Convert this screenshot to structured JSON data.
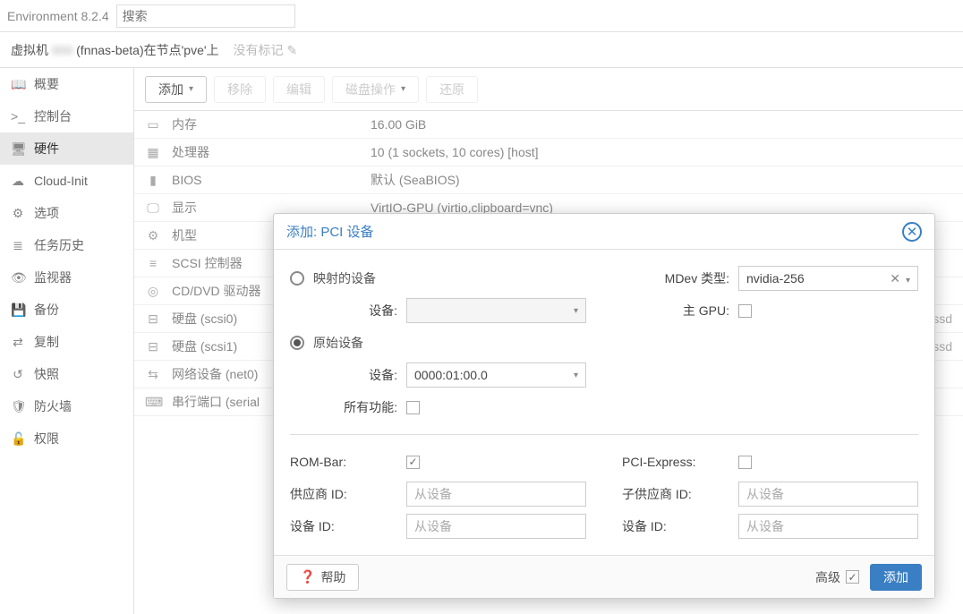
{
  "top": {
    "version": "Environment 8.2.4",
    "search_ph": "搜索"
  },
  "crumb": {
    "vm": "虚拟机",
    "host": "(fnnas-beta)在节点'pve'上",
    "tags": "没有标记",
    "edit_icon": "✎"
  },
  "sidebar": [
    {
      "icon": "📖",
      "label": "概要"
    },
    {
      "icon": ">_",
      "label": "控制台"
    },
    {
      "icon": "🖥",
      "label": "硬件",
      "active": true
    },
    {
      "icon": "☁",
      "label": "Cloud-Init"
    },
    {
      "icon": "⚙",
      "label": "选项"
    },
    {
      "icon": "≣",
      "label": "任务历史"
    },
    {
      "icon": "👁",
      "label": "监视器"
    },
    {
      "icon": "💾",
      "label": "备份"
    },
    {
      "icon": "⇄",
      "label": "复制"
    },
    {
      "icon": "↺",
      "label": "快照"
    },
    {
      "icon": "🛡",
      "label": "防火墙"
    },
    {
      "icon": "🔓",
      "label": "权限"
    }
  ],
  "toolbar": {
    "add": "添加",
    "remove": "移除",
    "edit": "编辑",
    "disk": "磁盘操作",
    "revert": "还原"
  },
  "hw": [
    {
      "icon": "▭",
      "label": "内存",
      "val": "16.00 GiB"
    },
    {
      "icon": "▦",
      "label": "处理器",
      "val": "10 (1 sockets, 10 cores) [host]"
    },
    {
      "icon": "▮",
      "label": "BIOS",
      "val": "默认 (SeaBIOS)"
    },
    {
      "icon": "🖵",
      "label": "显示",
      "val": "VirtIO-GPU (virtio,clipboard=vnc)"
    },
    {
      "icon": "⚙",
      "label": "机型",
      "val": ""
    },
    {
      "icon": "≡",
      "label": "SCSI 控制器",
      "val": ""
    },
    {
      "icon": "◎",
      "label": "CD/DVD 驱动器",
      "val": ""
    },
    {
      "icon": "⊟",
      "label": "硬盘 (scsi0)",
      "val": "",
      "tail": "ssd"
    },
    {
      "icon": "⊟",
      "label": "硬盘 (scsi1)",
      "val": "",
      "tail": "ssd"
    },
    {
      "icon": "⇆",
      "label": "网络设备 (net0)",
      "val": ""
    },
    {
      "icon": "⌨",
      "label": "串行端口 (serial",
      "val": ""
    }
  ],
  "modal": {
    "title": "添加: PCI 设备",
    "mapped": "映射的设备",
    "device": "设备:",
    "raw": "原始设备",
    "raw_val": "0000:01:00.0",
    "all_fn": "所有功能:",
    "mdev": "MDev 类型:",
    "mdev_val": "nvidia-256",
    "primary": "主 GPU:",
    "rombar": "ROM-Bar:",
    "pcie": "PCI-Express:",
    "vendor": "供应商 ID:",
    "device_id": "设备 ID:",
    "subvendor": "子供应商 ID:",
    "subdevice": "设备 ID:",
    "from_device": "从设备",
    "help": "帮助",
    "advanced": "高级",
    "submit": "添加"
  }
}
